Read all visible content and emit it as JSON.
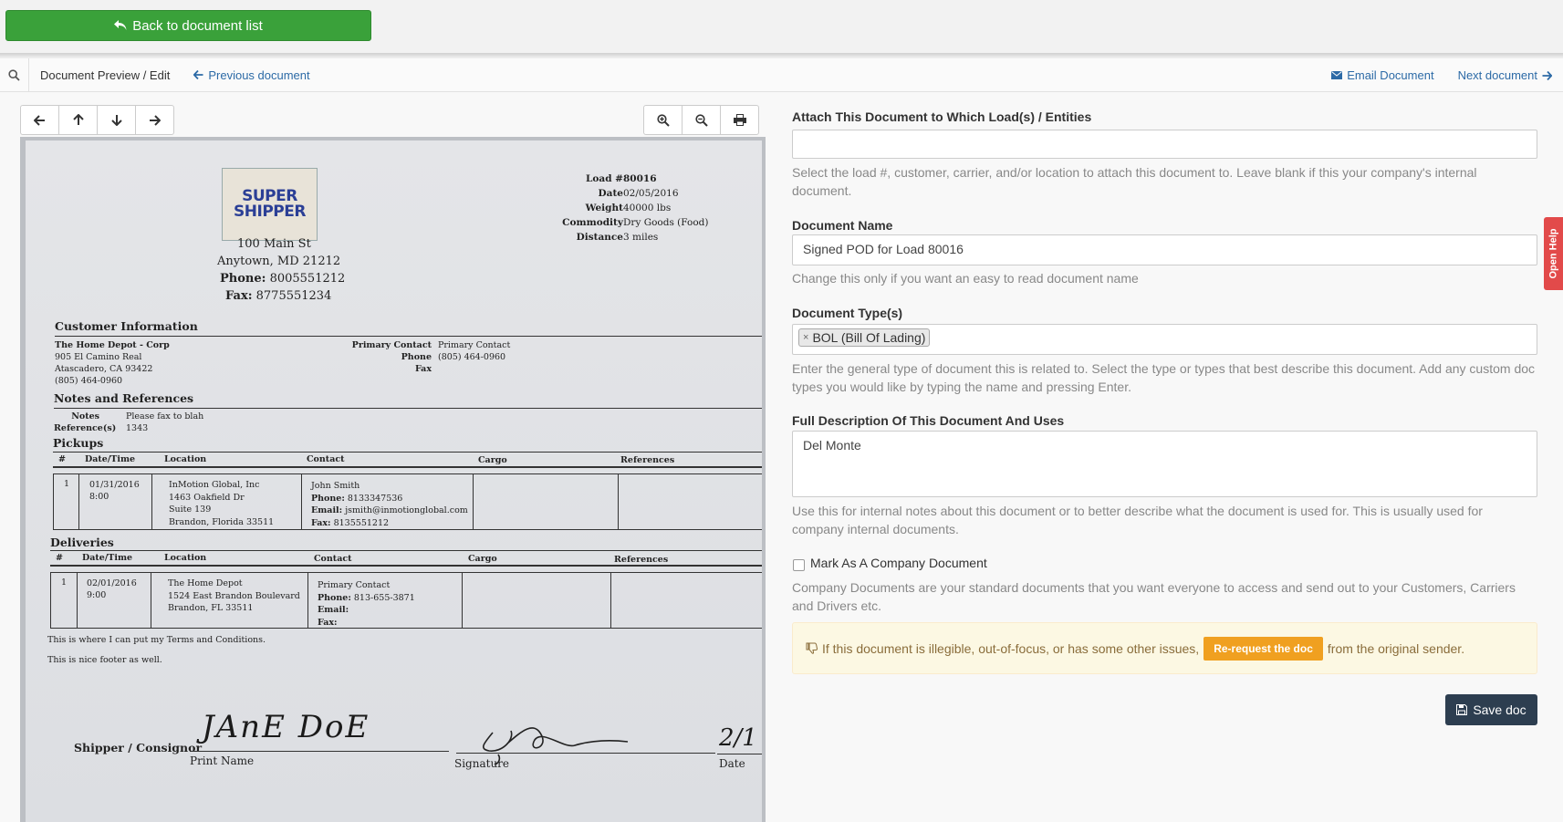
{
  "topbar": {
    "back_label": "Back to document list"
  },
  "navbar": {
    "title": "Document Preview / Edit",
    "previous": "Previous document",
    "email": "Email Document",
    "next": "Next document"
  },
  "document": {
    "logo_text": [
      "SUPER",
      "SHIPPER"
    ],
    "company": {
      "address1": "100 Main St",
      "address2": "Anytown, MD 21212",
      "phone_label": "Phone:",
      "phone": "8005551212",
      "fax_label": "Fax:",
      "fax": "8775551234"
    },
    "load_info": [
      {
        "label": "Load #",
        "value": "80016"
      },
      {
        "label": "Date",
        "value": "02/05/2016"
      },
      {
        "label": "Weight",
        "value": "40000 lbs"
      },
      {
        "label": "Commodity",
        "value": "Dry Goods (Food)"
      },
      {
        "label": "Distance",
        "value": "3 miles"
      }
    ],
    "customer": {
      "heading": "Customer Information",
      "lines": [
        "The Home Depot - Corp",
        "905 El Camino Real",
        "Atascadero, CA 93422",
        "(805) 464-0960"
      ],
      "contact_labels": [
        "Primary Contact",
        "Phone",
        "Fax"
      ],
      "contact_values": [
        "Primary Contact",
        "(805) 464-0960",
        ""
      ]
    },
    "notes": {
      "heading": "Notes and References",
      "notes_label": "Notes",
      "notes_value": "Please fax to blah",
      "ref_label": "Reference(s)",
      "ref_value": "1343"
    },
    "pickups": {
      "heading": "Pickups",
      "columns": [
        "#",
        "Date/Time",
        "Location",
        "Contact",
        "Cargo",
        "References"
      ],
      "row": {
        "num": "1",
        "date": "01/31/2016",
        "time": "8:00",
        "location": [
          "InMotion Global, Inc",
          "1463 Oakfield Dr",
          "Suite 139",
          "Brandon, Florida 33511"
        ],
        "contact_name": "John Smith",
        "phone_label": "Phone:",
        "phone": "8133347536",
        "email_label": "Email:",
        "email": "jsmith@inmotionglobal.com",
        "fax_label": "Fax:",
        "fax": "8135551212"
      }
    },
    "deliveries": {
      "heading": "Deliveries",
      "columns": [
        "#",
        "Date/Time",
        "Location",
        "Contact",
        "Cargo",
        "References"
      ],
      "row": {
        "num": "1",
        "date": "02/01/2016",
        "time": "9:00",
        "location": [
          "The Home Depot",
          "1524 East Brandon Boulevard",
          "Brandon, FL 33511"
        ],
        "contact_name": "Primary Contact",
        "phone_label": "Phone:",
        "phone": "813-655-3871",
        "email_label": "Email:",
        "fax_label": "Fax:"
      }
    },
    "terms": "This is where I can put my Terms and Conditions.",
    "footer": "This is nice footer as well.",
    "signature": {
      "party": "Shipper / Consignor",
      "print_name_label": "Print Name",
      "signature_label": "Signature",
      "date_label": "Date",
      "handwritten_name": "JAnE DoE",
      "handwritten_date": "2/1"
    }
  },
  "form": {
    "attach_label": "Attach This Document to Which Load(s) / Entities",
    "attach_value": "",
    "attach_help": "Select the load #, customer, carrier, and/or location to attach this document to. Leave blank if this your company's internal document.",
    "name_label": "Document Name",
    "name_value": "Signed POD for Load 80016",
    "name_help": "Change this only if you want an easy to read document name",
    "type_label": "Document Type(s)",
    "type_tag": "BOL (Bill Of Lading)",
    "type_help": "Enter the general type of document this is related to. Select the type or types that best describe this document. Add any custom doc types you would like by typing the name and pressing Enter.",
    "desc_label": "Full Description Of This Document And Uses",
    "desc_value": "Del Monte",
    "desc_help": "Use this for internal notes about this document or to better describe what the document is used for. This is usually used for company internal documents.",
    "company_doc_label": "Mark As A Company Document",
    "company_doc_help": "Company Documents are your standard documents that you want everyone to access and send out to your Customers, Carriers and Drivers etc.",
    "alert_text_before": "If this document is illegible, out-of-focus, or has some other issues,",
    "alert_button": "Re-request the doc",
    "alert_text_after": "from the original sender.",
    "save_label": "Save doc"
  },
  "open_help_label": "Open Help",
  "colors": {
    "green": "#3aa13a",
    "link": "#2c6aa6",
    "orange": "#f0a020",
    "navy": "#2d3e50",
    "help_red": "#e24a4a"
  }
}
